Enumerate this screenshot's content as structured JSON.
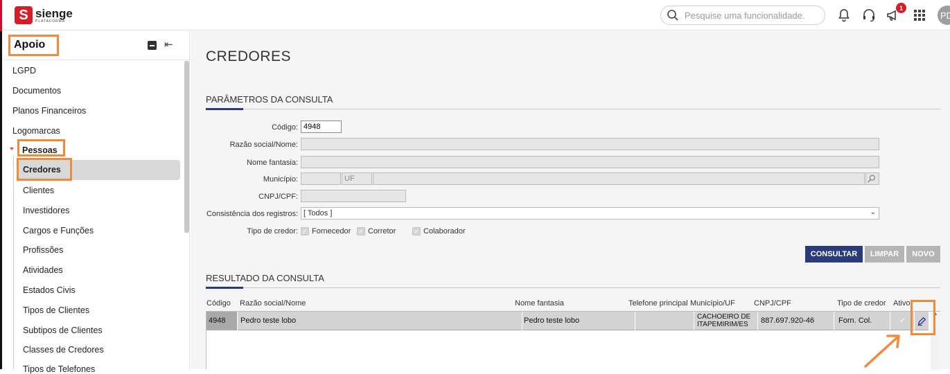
{
  "header": {
    "brand": "sienge",
    "brand_sub": "PLATAFORMA",
    "search_placeholder": "Pesquise uma funcionalidade.",
    "notification_count": "1",
    "avatar_initials": "PD"
  },
  "sidebar": {
    "title": "Apoio",
    "items": [
      {
        "label": "LGPD"
      },
      {
        "label": "Documentos"
      },
      {
        "label": "Planos Financeiros"
      },
      {
        "label": "Logomarcas"
      },
      {
        "label": "Pessoas"
      },
      {
        "label": "Credores"
      },
      {
        "label": "Clientes"
      },
      {
        "label": "Investidores"
      },
      {
        "label": "Cargos e Funções"
      },
      {
        "label": "Profissões"
      },
      {
        "label": "Atividades"
      },
      {
        "label": "Estados Civis"
      },
      {
        "label": "Tipos de Clientes"
      },
      {
        "label": "Subtipos de Clientes"
      },
      {
        "label": "Classes de Credores"
      },
      {
        "label": "Tipos de Telefones"
      }
    ]
  },
  "page": {
    "title": "CREDORES",
    "params_title": "PARÂMETROS DA CONSULTA",
    "results_title": "RESULTADO DA CONSULTA"
  },
  "form": {
    "codigo_label": "Código:",
    "codigo_value": "4948",
    "razao_label": "Razão social/Nome:",
    "fantasia_label": "Nome fantasia:",
    "municipio_label": "Município:",
    "uf_placeholder": "UF",
    "cnpj_label": "CNPJ/CPF:",
    "consistencia_label": "Consistência dos registros:",
    "consistencia_value": "[ Todos ]",
    "tipo_label": "Tipo de credor:",
    "tipo_options": [
      "Fornecedor",
      "Corretor",
      "Colaborador"
    ]
  },
  "buttons": {
    "consultar": "CONSULTAR",
    "limpar": "LIMPAR",
    "novo": "NOVO"
  },
  "table": {
    "headers": [
      "Código",
      "Razão social/Nome",
      "Nome fantasia",
      "Telefone principal",
      "Município/UF",
      "CNPJ/CPF",
      "Tipo de credor",
      "Ativo"
    ],
    "rows": [
      {
        "codigo": "4948",
        "razao": "Pedro teste lobo",
        "fantasia": "Pedro teste lobo",
        "telefone": "",
        "municipio": "CACHOEIRO DE ITAPEMIRIM/ES",
        "cnpj": "887.697.920-46",
        "tipo": "Forn. Col.",
        "ativo": "✓"
      }
    ]
  },
  "colors": {
    "brand_red": "#d71e28",
    "consultar_bg": "#2b3a7a",
    "highlight_orange": "#f08a3c",
    "disabled_btn": "#b5b5b5"
  }
}
